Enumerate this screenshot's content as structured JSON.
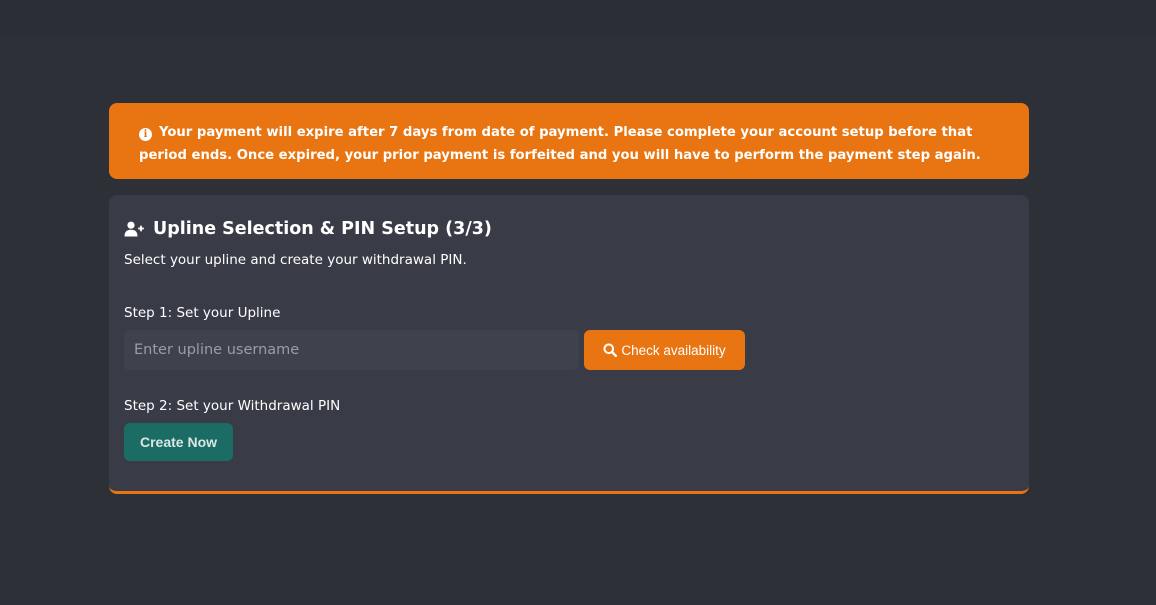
{
  "alert": {
    "icon": "info-circle-icon",
    "icon_glyph": "i",
    "message": "Your payment will expire after 7 days from date of payment. Please complete your account setup before that period ends. Once expired, your prior payment is forfeited and you will have to perform the payment step again.",
    "color": "#e87511"
  },
  "card": {
    "icon": "user-plus-icon",
    "title": "Upline Selection & PIN Setup (3/3)",
    "subtitle": "Select your upline and create your withdrawal PIN.",
    "step1": {
      "label": "Step 1: Set your Upline",
      "input_placeholder": "Enter upline username",
      "input_value": "",
      "button_icon": "search-icon",
      "button_label": "Check availability"
    },
    "step2": {
      "label": "Step 2: Set your Withdrawal PIN",
      "button_label": "Create Now"
    }
  },
  "colors": {
    "accent": "#e87511",
    "background": "#2e3038",
    "card": "#393b46",
    "secondary_button": "#1b6c64"
  }
}
